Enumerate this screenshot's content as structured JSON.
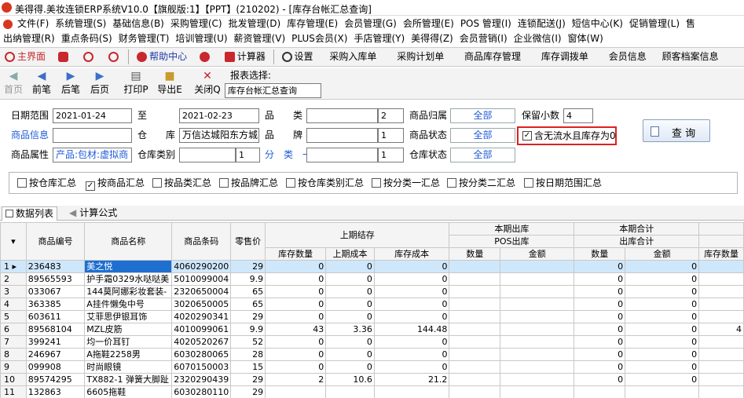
{
  "title": "美得得.美妆连锁ERP系统V10.0【旗舰版:1】【PPT】(210202) - [库存台帐汇总查询]",
  "menu1": [
    "文件(F)",
    "系统管理(S)",
    "基础信息(B)",
    "采购管理(C)",
    "批发管理(D)",
    "库存管理(E)",
    "会员管理(G)",
    "会所管理(E)",
    "POS 管理(I)",
    "连锁配送(J)",
    "短信中心(K)",
    "促销管理(L)",
    "售"
  ],
  "menu2": [
    "出纳管理(R)",
    "重点条码(S)",
    "财务管理(T)",
    "培训管理(U)",
    "薪资管理(V)",
    "PLUS会员(X)",
    "手店管理(Y)",
    "美得得(Z)",
    "会员营销(I)",
    "企业微信(I)",
    "窗体(W)"
  ],
  "toolbar1": {
    "home": "主界面",
    "help": "帮助中心",
    "calc": "计算器",
    "settings": "设置",
    "b1": "采购入库单",
    "b2": "采购计划单",
    "b3": "商品库存管理",
    "b4": "库存调拨单",
    "b5": "会员信息",
    "b6": "顾客档案信息"
  },
  "toolbar2": {
    "first": "首页",
    "prev": "前笔",
    "next": "后笔",
    "last": "后页",
    "print": "打印P",
    "export": "导出E",
    "close": "关闭Q",
    "report_label": "报表选择:",
    "report_value": "库存台帐汇总查询"
  },
  "form": {
    "date_label": "日期范围",
    "date_from": "2021-01-24",
    "to_label": "至",
    "date_to": "2021-02-23",
    "category_label": "品　　类",
    "category_value": "",
    "category_num": "2",
    "owner_label": "商品归属",
    "owner_value": "全部",
    "decimals_label": "保留小数",
    "decimals_value": "4",
    "goods_label": "商品信息",
    "goods_value": "",
    "warehouse_label": "仓　　库",
    "warehouse_value": "万信达城阳东方城",
    "brand_label": "品　　牌",
    "brand_value": "",
    "brand_num": "1",
    "status_label": "商品状态",
    "status_value": "全部",
    "nozero_label": "含无流水且库存为0",
    "attr_label": "商品属性",
    "attr_value": "产品:包材:虚拟商",
    "whcat_label": "仓库类别",
    "whcat_value": "",
    "whcat_num": "1",
    "class1_label": "分　类　一",
    "class1_value": "",
    "class1_num": "1",
    "whstatus_label": "仓库状态",
    "whstatus_value": "全部",
    "query_btn": "查 询"
  },
  "checks": [
    {
      "label": "按仓库汇总",
      "checked": false
    },
    {
      "label": "按商品汇总",
      "checked": true
    },
    {
      "label": "按品类汇总",
      "checked": false
    },
    {
      "label": "按品牌汇总",
      "checked": false
    },
    {
      "label": "按仓库类别汇总",
      "checked": false
    },
    {
      "label": "按分类一汇总",
      "checked": false
    },
    {
      "label": "按分类二汇总",
      "checked": false
    },
    {
      "label": "按日期范围汇总",
      "checked": false
    }
  ],
  "tabs": {
    "t1": "数据列表",
    "t2": "计算公式"
  },
  "grid": {
    "h_code": "商品编号",
    "h_name": "商品名称",
    "h_barcode": "商品条码",
    "h_price": "零售价",
    "h_prev": "上期结存",
    "h_out": "本期出库",
    "h_total": "本期合计",
    "h_pos": "POS出库",
    "h_outtotal": "出库合计",
    "h_prevqty": "库存数量",
    "h_prevcost": "上期成本",
    "h_stockcost": "库存成本",
    "h_qty": "数量",
    "h_amt": "金额",
    "h_qty2": "数量",
    "h_amt2": "金额",
    "h_stockqty": "库存数量",
    "rows": [
      [
        "1",
        "236483",
        "美之悦",
        "4060290200",
        "29",
        "0",
        "0",
        "0",
        "",
        "",
        "0",
        "0",
        ""
      ],
      [
        "2",
        "89565593",
        "护手霜0329水哒哒美",
        "5010099004",
        "9.9",
        "0",
        "0",
        "0",
        "",
        "",
        "0",
        "0",
        ""
      ],
      [
        "3",
        "033067",
        "144莫阿娜彩妆套装-",
        "2320650004",
        "65",
        "0",
        "0",
        "0",
        "",
        "",
        "0",
        "0",
        ""
      ],
      [
        "4",
        "363385",
        "A挂件懒兔中号",
        "3020650005",
        "65",
        "0",
        "0",
        "0",
        "",
        "",
        "0",
        "0",
        ""
      ],
      [
        "5",
        "603611",
        "艾菲思伊银耳饰",
        "4020290341",
        "29",
        "0",
        "0",
        "0",
        "",
        "",
        "0",
        "0",
        ""
      ],
      [
        "6",
        "89568104",
        "MZL皮筋",
        "4010099061",
        "9.9",
        "43",
        "3.36",
        "144.48",
        "",
        "",
        "0",
        "0",
        "4"
      ],
      [
        "7",
        "399241",
        "均一价耳钉",
        "4020520267",
        "52",
        "0",
        "0",
        "0",
        "",
        "",
        "0",
        "0",
        ""
      ],
      [
        "8",
        "246967",
        "A拖鞋2258男",
        "6030280065",
        "28",
        "0",
        "0",
        "0",
        "",
        "",
        "0",
        "0",
        ""
      ],
      [
        "9",
        "099908",
        "时尚眼镜",
        "6070150003",
        "15",
        "0",
        "0",
        "0",
        "",
        "",
        "0",
        "0",
        ""
      ],
      [
        "10",
        "89574295",
        "TX882-1 弹簧大脚趾",
        "2320290439",
        "29",
        "2",
        "10.6",
        "21.2",
        "",
        "",
        "0",
        "0",
        ""
      ],
      [
        "11",
        "132863",
        "6605拖鞋",
        "6030280110",
        "29",
        "",
        "",
        "",
        "",
        "",
        "",
        "",
        ""
      ]
    ]
  }
}
